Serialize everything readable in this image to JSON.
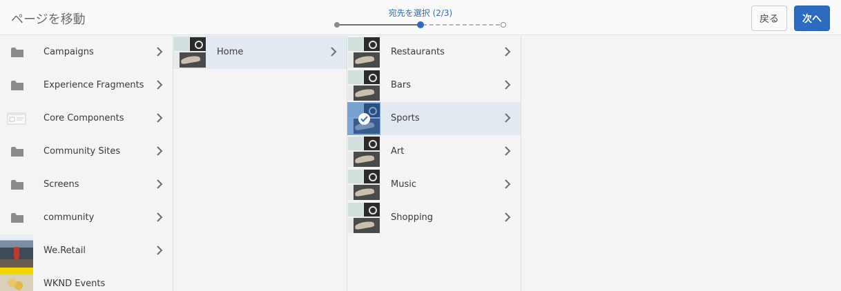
{
  "header": {
    "title": "ページを移動",
    "wizard_step_label": "宛先を選択 (2/3)",
    "back_label": "戻る",
    "next_label": "次へ"
  },
  "colors": {
    "accent": "#2d6bc1",
    "selected_row": "#e3e9f1",
    "background": "#f4f4f4"
  },
  "column1": {
    "items": [
      {
        "label": "Campaigns",
        "icon": "folder-icon"
      },
      {
        "label": "Experience Fragments",
        "icon": "folder-icon"
      },
      {
        "label": "Core Components",
        "icon": "site-template-icon"
      },
      {
        "label": "Community Sites",
        "icon": "folder-icon"
      },
      {
        "label": "Screens",
        "icon": "folder-icon"
      },
      {
        "label": "community",
        "icon": "folder-icon"
      },
      {
        "label": "We.Retail",
        "icon": "page-thumbnail"
      },
      {
        "label": "WKND Events",
        "icon": "page-thumbnail"
      }
    ]
  },
  "column2": {
    "items": [
      {
        "label": "Home",
        "selected": true
      }
    ]
  },
  "column3": {
    "items": [
      {
        "label": "Restaurants",
        "checked": false
      },
      {
        "label": "Bars",
        "checked": false
      },
      {
        "label": "Sports",
        "checked": true
      },
      {
        "label": "Art",
        "checked": false
      },
      {
        "label": "Music",
        "checked": false
      },
      {
        "label": "Shopping",
        "checked": false
      }
    ]
  }
}
